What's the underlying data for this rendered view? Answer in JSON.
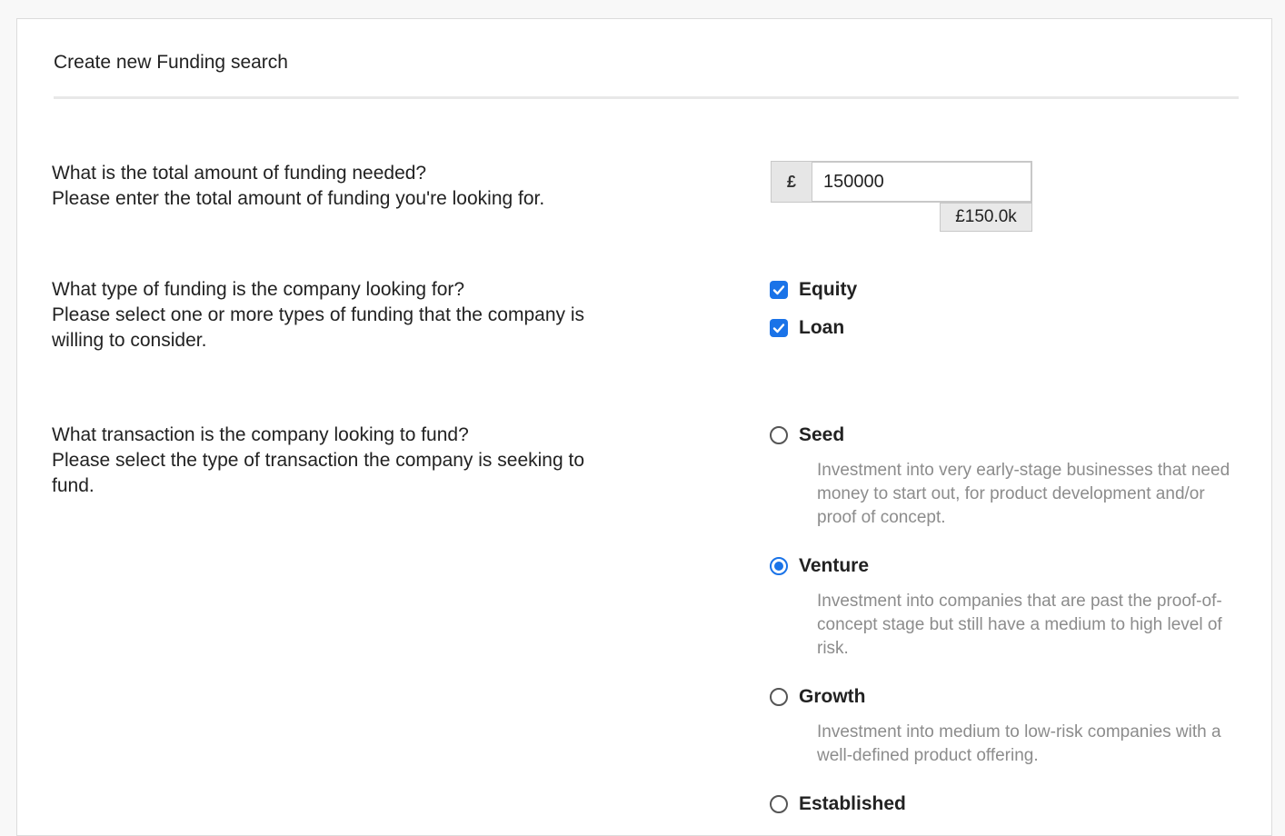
{
  "header": {
    "title": "Create new Funding search"
  },
  "amount": {
    "question": "What is the total amount of funding needed?",
    "help": "Please enter the total amount of funding you're looking for.",
    "currency_symbol": "£",
    "value": "150000",
    "formatted": "£150.0k"
  },
  "funding_type": {
    "question": "What type of funding is the company looking for?",
    "help": "Please select one or more types of funding that the company is willing to consider.",
    "options": [
      {
        "label": "Equity",
        "checked": true
      },
      {
        "label": "Loan",
        "checked": true
      }
    ]
  },
  "transaction": {
    "question": "What transaction is the company looking to fund?",
    "help": "Please select the type of transaction the company is seeking to fund.",
    "options": [
      {
        "label": "Seed",
        "selected": false,
        "description": "Investment into very early-stage businesses that need money to start out, for product development and/or proof of concept."
      },
      {
        "label": "Venture",
        "selected": true,
        "description": "Investment into companies that are past the proof-of-concept stage but still have a medium to high level of risk."
      },
      {
        "label": "Growth",
        "selected": false,
        "description": "Investment into medium to low-risk companies with a well-defined product offering."
      },
      {
        "label": "Established",
        "selected": false,
        "description": ""
      }
    ]
  },
  "colors": {
    "accent": "#1a73e8",
    "muted_text": "#8c8c8c"
  }
}
